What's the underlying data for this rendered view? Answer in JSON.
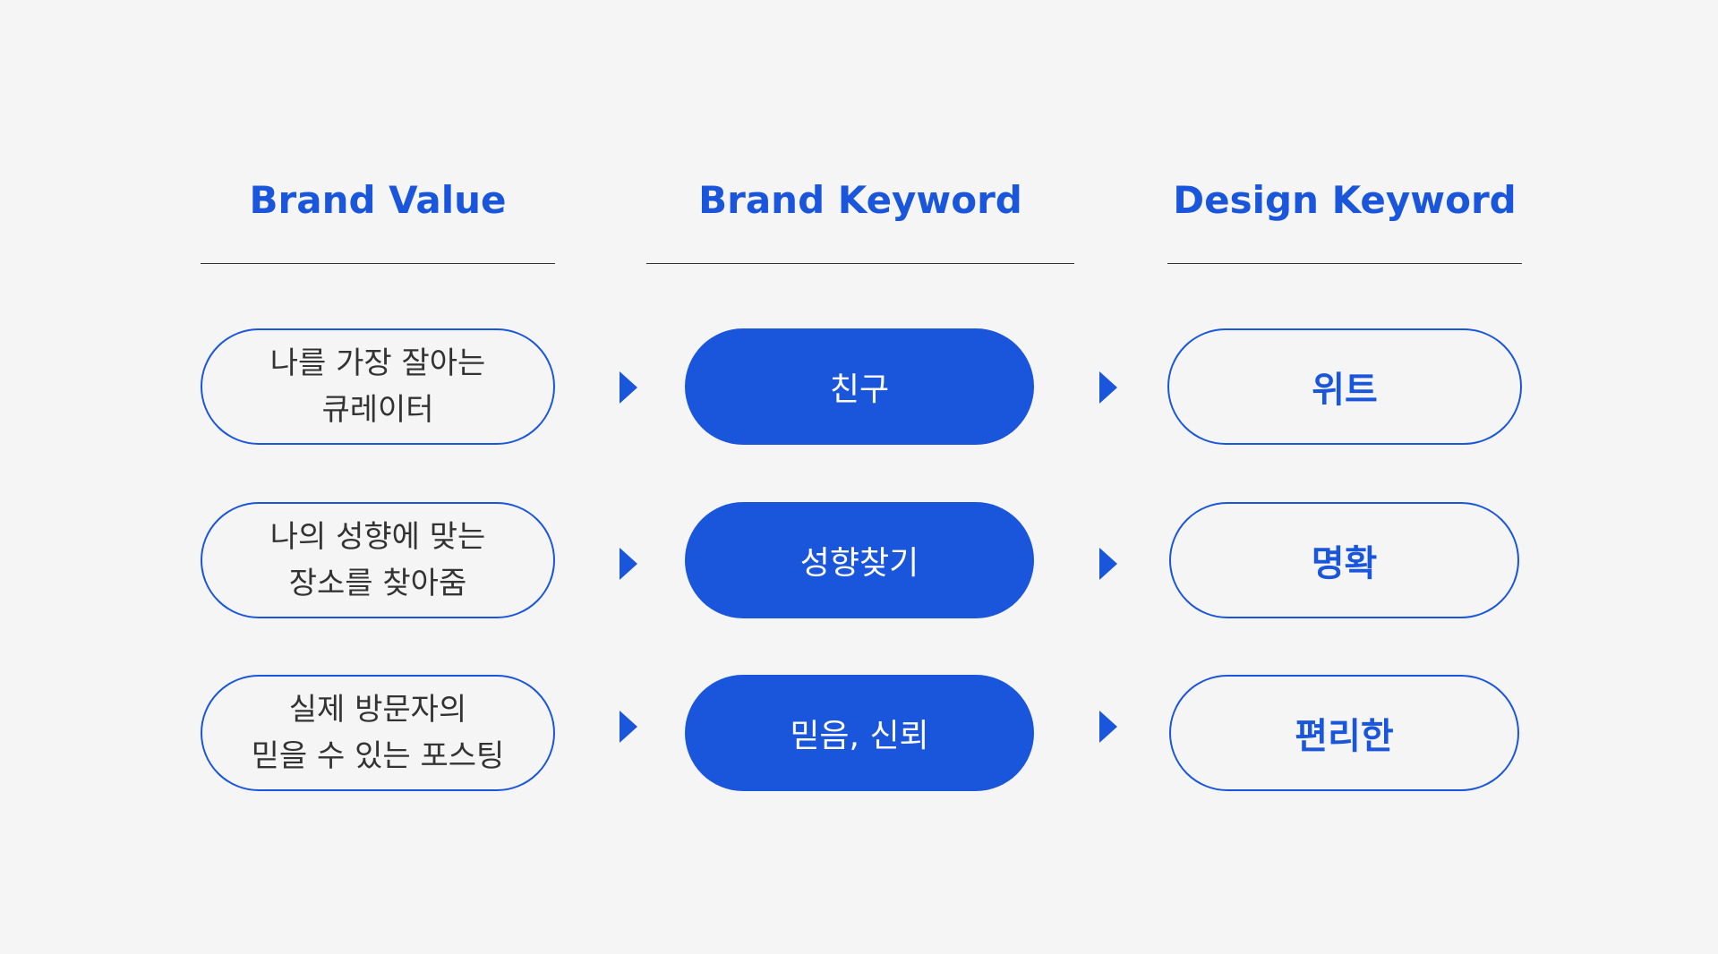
{
  "headers": {
    "brand_value": "Brand Value",
    "brand_keyword": "Brand Keyword",
    "design_keyword": "Design Keyword"
  },
  "rows": [
    {
      "value": [
        "나를 가장 잘아는",
        "큐레이터"
      ],
      "keyword": "친구",
      "design": "위트"
    },
    {
      "value": [
        "나의 성향에 맞는",
        "장소를 찾아줌"
      ],
      "keyword": "성향찾기",
      "design": "명확"
    },
    {
      "value": [
        "실제 방문자의",
        "믿을 수 있는 포스팅"
      ],
      "keyword": "믿음, 신뢰",
      "design": "편리한"
    }
  ],
  "colors": {
    "accent": "#1a56db",
    "background": "#f5f5f5",
    "text": "#333333",
    "rule": "#333333"
  },
  "icons": [
    "triangle-right-arrow-icon"
  ]
}
